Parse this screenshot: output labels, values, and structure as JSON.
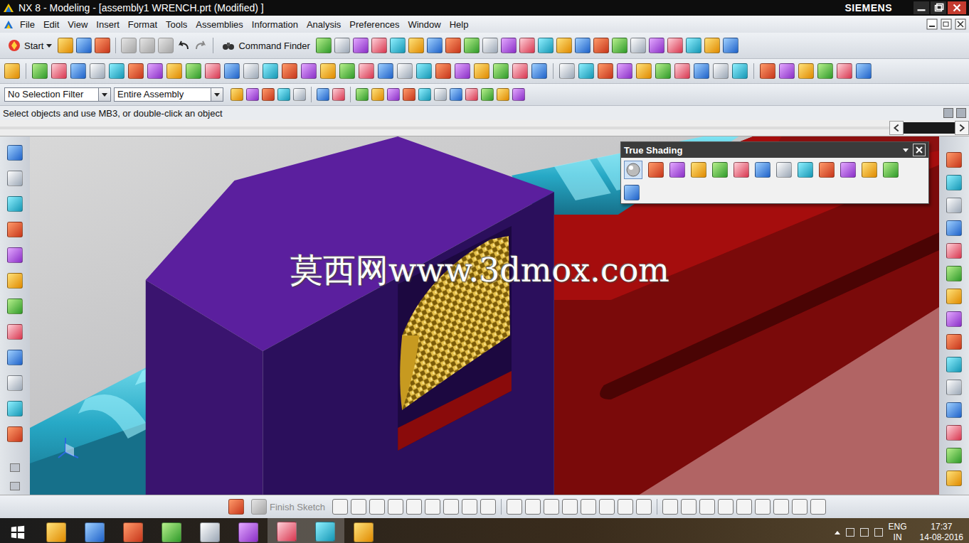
{
  "window": {
    "title": "NX 8 - Modeling - [assembly1 WRENCH.prt (Modified) ]",
    "brand": "SIEMENS"
  },
  "menu": [
    "File",
    "Edit",
    "View",
    "Insert",
    "Format",
    "Tools",
    "Assemblies",
    "Information",
    "Analysis",
    "Preferences",
    "Window",
    "Help"
  ],
  "toolbar": {
    "start": "Start",
    "command_finder": "Command Finder"
  },
  "selection": {
    "filter": "No Selection Filter",
    "scope": "Entire Assembly"
  },
  "prompt": "Select objects and use MB3, or double-click an object",
  "viewport": {
    "watermark": "莫西网www.3dmox.com"
  },
  "palette": {
    "title": "True Shading"
  },
  "sketch_toolbar": {
    "finish": "Finish Sketch",
    "disabled": true
  },
  "taskbar": {
    "language": "ENG",
    "region": "IN",
    "time": "17:37",
    "date": "14-08-2016"
  }
}
